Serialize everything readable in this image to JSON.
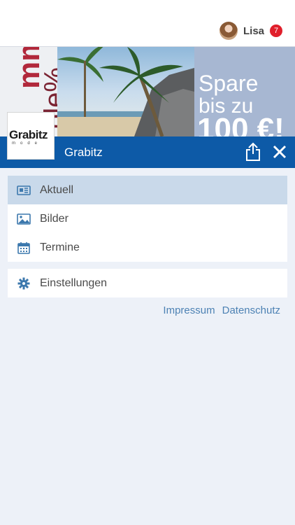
{
  "user": {
    "name": "Lisa",
    "notifications": "7"
  },
  "banner": {
    "left_text_1": "mmel",
    "left_text_2": "ble%",
    "promo_line1": "Spare",
    "promo_line2": "bis zu",
    "promo_line3": "100 €!"
  },
  "header": {
    "logo_brand": "Grabitz",
    "logo_sub": "mode",
    "title": "Grabitz"
  },
  "menu": {
    "items": [
      {
        "label": "Aktuell",
        "icon": "newspaper-icon"
      },
      {
        "label": "Bilder",
        "icon": "image-icon"
      },
      {
        "label": "Termine",
        "icon": "calendar-icon"
      }
    ],
    "settings_label": "Einstellungen"
  },
  "footer_links": {
    "impressum": "Impressum",
    "datenschutz": "Datenschutz"
  },
  "colors": {
    "header": "#0d5aa7",
    "accent": "#4d82b4",
    "active_item": "#c9d9ea",
    "badge": "#e01f2b"
  }
}
